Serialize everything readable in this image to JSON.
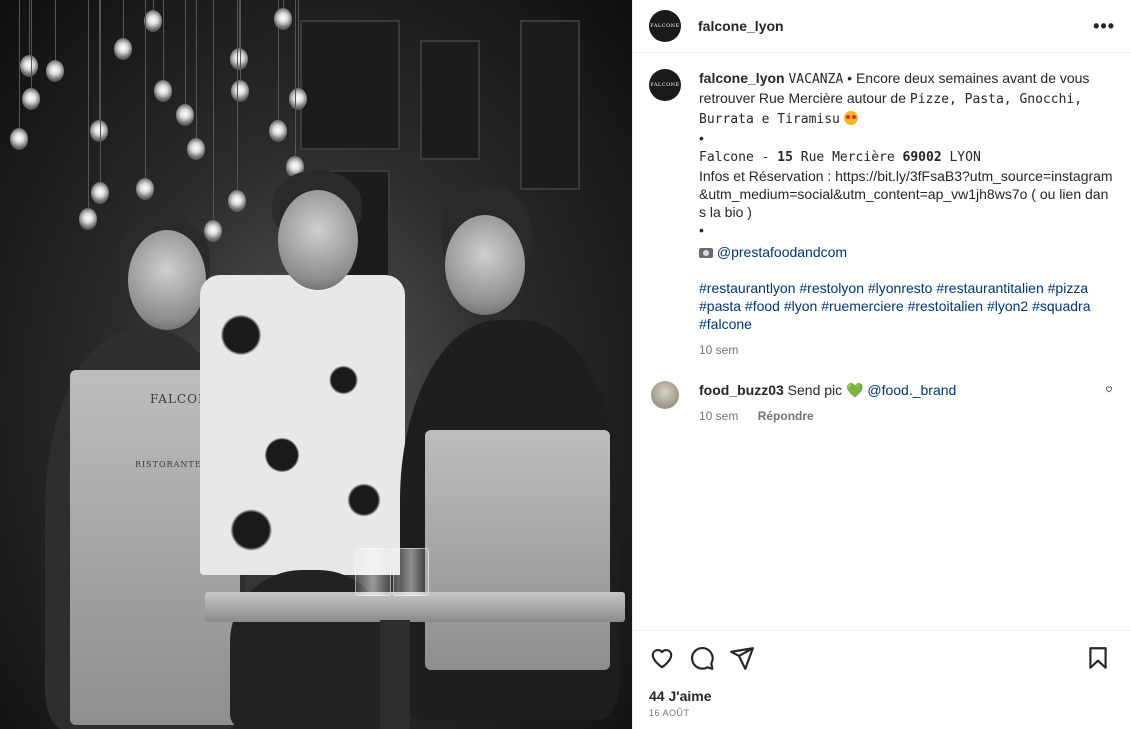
{
  "header": {
    "avatar_text": "FALCONE",
    "username": "falcone_lyon",
    "more_label": "•••"
  },
  "caption": {
    "username": "falcone_lyon",
    "line1_a": "VACANZA",
    "line1_b": " • Encore deux semaines avant de vous retrouver Rue Mercière autour de ",
    "foods": "Pizze, Pasta, Gnocchi, Burrata e Tiramisu",
    "bullet1": "•",
    "address_a": "Falcone - ",
    "address_b": "15",
    "address_c": " Rue Mercière ",
    "address_d": "69002",
    "address_e": " LYON",
    "infos": "Infos et Réservation : https://bit.ly/3fFsaB3?utm_source=instagram&utm_medium=social&utm_content=ap_vw1jh8ws7o ( ou lien dans la bio )",
    "bullet2": "•",
    "credit": "@prestafoodandcom",
    "hashtags": "#restaurantlyon #restolyon #lyonresto #restaurantitalien #pizza #pasta #food #lyon #ruemerciere #restoitalien #lyon2 #squadra #falcone",
    "time": "10 sem"
  },
  "comment": {
    "username": "food_buzz03",
    "text": "Send pic",
    "heart": "💚",
    "mention": "@food._brand",
    "time": "10 sem",
    "reply_label": "Répondre"
  },
  "photo": {
    "apron_brand": "FALCONE",
    "apron_sub": "RISTORANTE E PIZZERIA"
  },
  "actions": {
    "likes": "44 J'aime",
    "date": "16 AOÛT"
  }
}
